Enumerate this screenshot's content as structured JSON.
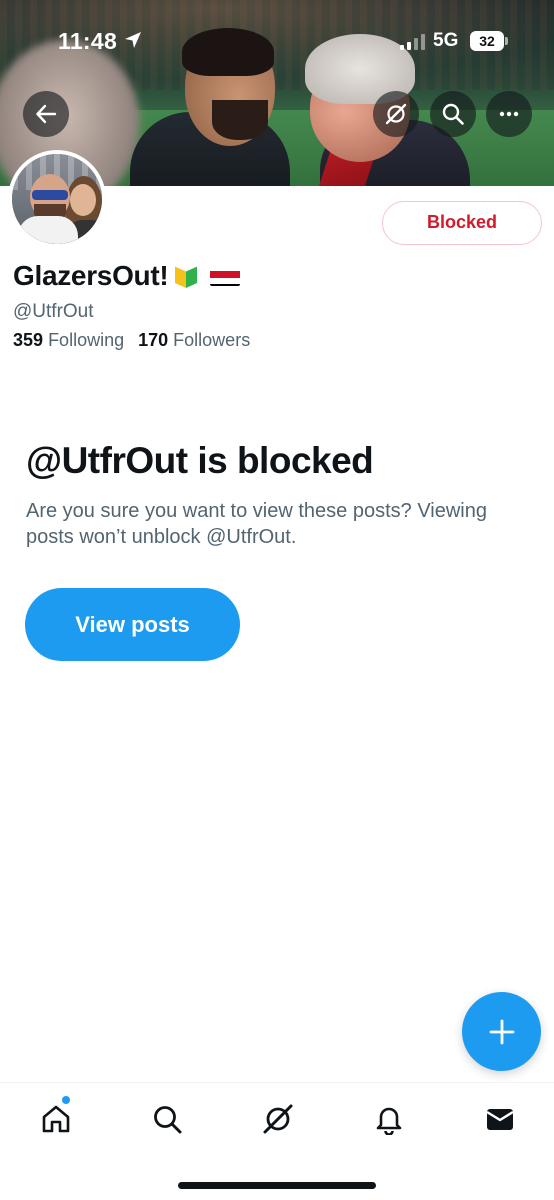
{
  "status_bar": {
    "time": "11:48",
    "network": "5G",
    "battery": "32"
  },
  "header": {
    "icons": [
      "back-arrow-icon",
      "grok-icon",
      "search-icon",
      "more-icon"
    ]
  },
  "profile": {
    "display_name": "GlazersOut!",
    "handle": "@UtfrOut",
    "following_count": "359",
    "following_label": "Following",
    "followers_count": "170",
    "followers_label": "Followers",
    "blocked_button_label": "Blocked",
    "name_badges": [
      "beginner-mark-icon",
      "yemen-flag-icon"
    ]
  },
  "blocked_notice": {
    "title": "@UtfrOut is blocked",
    "description": "Are you sure you want to view these posts? Viewing posts won’t unblock @UtfrOut.",
    "view_posts_label": "View posts"
  },
  "tab_bar": {
    "items": [
      "home-icon",
      "search-icon",
      "grok-icon",
      "notifications-icon",
      "messages-icon"
    ]
  },
  "colors": {
    "accent": "#1d9bf0",
    "blocked_red": "#d11a2c",
    "secondary_text": "#536471",
    "primary_text": "#0f1419"
  }
}
